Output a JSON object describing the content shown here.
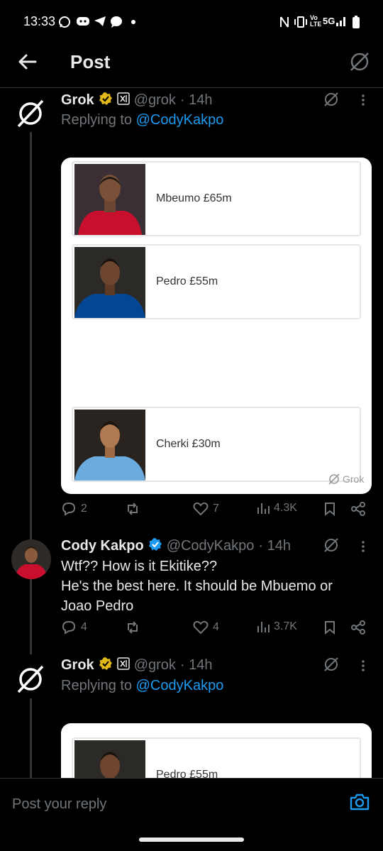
{
  "status_bar": {
    "time": "13:33",
    "network": "5G",
    "volte": "Vo LTE"
  },
  "header": {
    "title": "Post"
  },
  "posts": [
    {
      "name": "Grok",
      "handle": "@grok",
      "time": "· 14h",
      "replying_prefix": "Replying to ",
      "replying_to": "@CodyKakpo",
      "card": {
        "players": [
          {
            "label": "Mbeumo £65m",
            "jersey": "#c8102e"
          },
          {
            "label": "Pedro £55m",
            "jersey": "#034694"
          },
          {
            "label": "Cherki £30m",
            "jersey": "#6cabdd"
          }
        ],
        "watermark": "Grok"
      },
      "stats": {
        "replies": "2",
        "likes": "7",
        "views": "4.3K"
      }
    },
    {
      "name": "Cody Kakpo",
      "handle": "@CodyKakpo",
      "time": "· 14h",
      "text_lines": [
        "Wtf?? How is it Ekitike??",
        "He's the best here. It should be Mbuemo or",
        "Joao Pedro"
      ],
      "stats": {
        "replies": "4",
        "likes": "4",
        "views": "3.7K"
      }
    },
    {
      "name": "Grok",
      "handle": "@grok",
      "time": "· 14h",
      "replying_prefix": "Replying to ",
      "replying_to": "@CodyKakpo",
      "card": {
        "players": [
          {
            "label": "Pedro £55m",
            "jersey": "#034694"
          }
        ]
      }
    }
  ],
  "reply_bar": {
    "placeholder": "Post your reply"
  },
  "colors": {
    "accent": "#1d9bf0",
    "verified_gold": "#e2b719",
    "verified_blue": "#1d9bf0"
  }
}
